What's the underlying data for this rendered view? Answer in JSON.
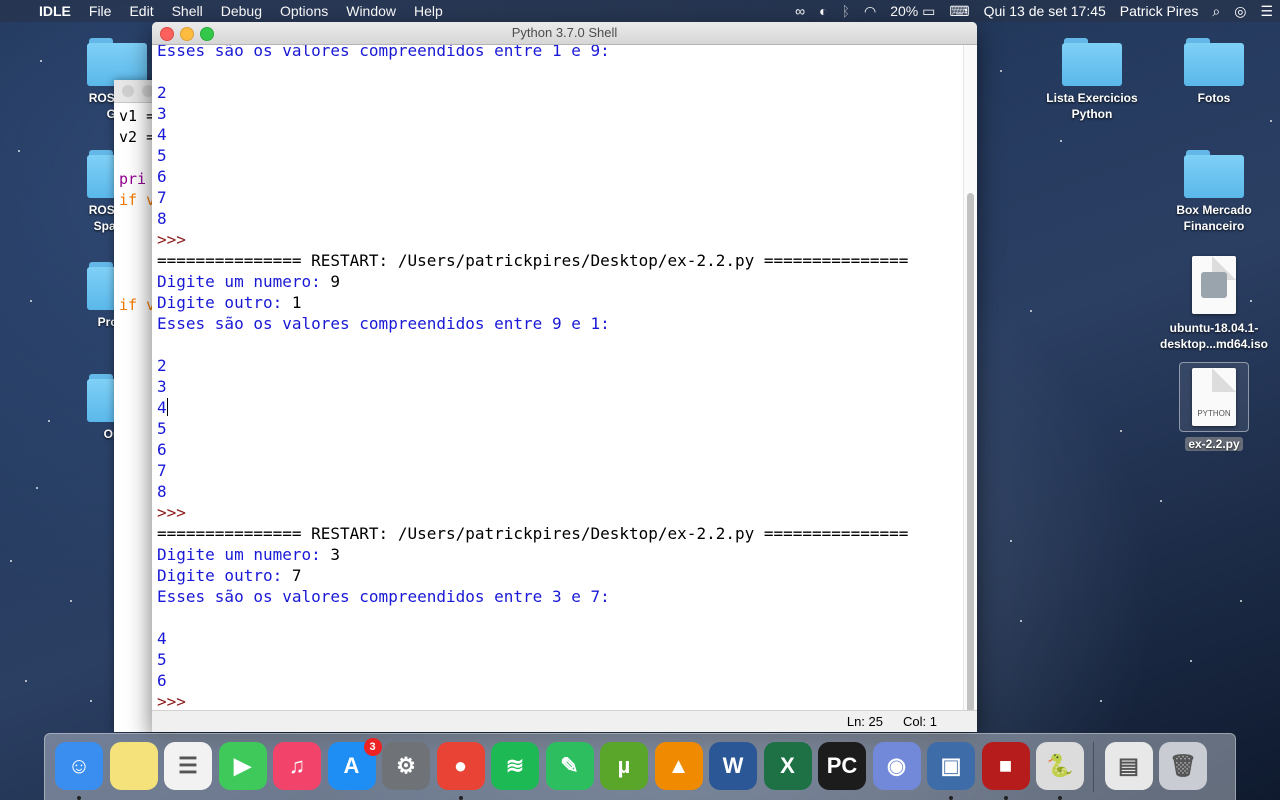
{
  "menubar": {
    "app_name": "IDLE",
    "menus": [
      "File",
      "Edit",
      "Shell",
      "Debug",
      "Options",
      "Window",
      "Help"
    ],
    "battery": "20%",
    "datetime": "Qui 13 de set  17:45",
    "user": "Patrick Pires"
  },
  "desktop": {
    "left_icons": [
      {
        "label": "ROSETTA",
        "label2": "Ger"
      },
      {
        "label": "ROSETTA",
        "label2": "Spanish"
      },
      {
        "label": "Progra",
        "label2": ""
      },
      {
        "label": "Onel",
        "label2": ""
      }
    ],
    "right_icons": [
      {
        "label": "Lista Exercicios",
        "label2": "Python"
      },
      {
        "label": "Fotos",
        "label2": ""
      },
      {
        "label": "Box Mercado",
        "label2": "Financeiro"
      },
      {
        "label": "ubuntu-18.04.1-",
        "label2": "desktop...md64.iso"
      },
      {
        "label": "ex-2.2.py",
        "label2": "",
        "doc_label": "PYTHON"
      }
    ]
  },
  "bg_editor": {
    "lines": [
      "v1 =",
      "v2 =",
      "",
      "pri",
      "if v",
      "",
      "",
      "",
      "",
      "if v"
    ]
  },
  "shell_window": {
    "title": "Python 3.7.0 Shell",
    "lines": [
      {
        "t": "Esses são os valores compreendidos entre 1 e 9:",
        "c": "out"
      },
      {
        "t": "",
        "c": "out"
      },
      {
        "t": "2",
        "c": "out"
      },
      {
        "t": "3",
        "c": "out"
      },
      {
        "t": "4",
        "c": "out"
      },
      {
        "t": "5",
        "c": "out"
      },
      {
        "t": "6",
        "c": "out"
      },
      {
        "t": "7",
        "c": "out"
      },
      {
        "t": "8",
        "c": "out"
      },
      {
        "t": ">>> ",
        "c": "prompt"
      },
      {
        "t": "=============== RESTART: /Users/patrickpires/Desktop/ex-2.2.py ===============",
        "c": "rst"
      },
      {
        "t": "Digite um numero: ",
        "c": "out",
        "u": "9"
      },
      {
        "t": "Digite outro: ",
        "c": "out",
        "u": "1"
      },
      {
        "t": "Esses são os valores compreendidos entre 9 e 1:",
        "c": "out"
      },
      {
        "t": "",
        "c": "out"
      },
      {
        "t": "2",
        "c": "out"
      },
      {
        "t": "3",
        "c": "out"
      },
      {
        "t": "4",
        "c": "out",
        "cursor": true
      },
      {
        "t": "5",
        "c": "out"
      },
      {
        "t": "6",
        "c": "out"
      },
      {
        "t": "7",
        "c": "out"
      },
      {
        "t": "8",
        "c": "out"
      },
      {
        "t": ">>> ",
        "c": "prompt"
      },
      {
        "t": "=============== RESTART: /Users/patrickpires/Desktop/ex-2.2.py ===============",
        "c": "rst"
      },
      {
        "t": "Digite um numero: ",
        "c": "out",
        "u": "3"
      },
      {
        "t": "Digite outro: ",
        "c": "out",
        "u": "7"
      },
      {
        "t": "Esses são os valores compreendidos entre 3 e 7:",
        "c": "out"
      },
      {
        "t": "",
        "c": "out"
      },
      {
        "t": "4",
        "c": "out"
      },
      {
        "t": "5",
        "c": "out"
      },
      {
        "t": "6",
        "c": "out"
      },
      {
        "t": ">>> ",
        "c": "prompt"
      }
    ],
    "status_ln": "Ln: 25",
    "status_col": "Col: 1"
  },
  "dock": {
    "apps": [
      {
        "name": "finder-icon",
        "glyph": "☺",
        "color": "#3a8ef0",
        "dot": true
      },
      {
        "name": "notes-icon",
        "glyph": "",
        "color": "#f5e27a",
        "dot": false
      },
      {
        "name": "reminders-icon",
        "glyph": "☰",
        "color": "#f2f2f2",
        "dot": false
      },
      {
        "name": "facetime-icon",
        "glyph": "▶",
        "color": "#3ec95a",
        "dot": false
      },
      {
        "name": "itunes-icon",
        "glyph": "♫",
        "color": "#f2436a",
        "dot": false
      },
      {
        "name": "app-store-icon",
        "glyph": "A",
        "color": "#1e8ef5",
        "dot": false,
        "badge": "3"
      },
      {
        "name": "system-preferences-icon",
        "glyph": "⚙",
        "color": "#6f7378",
        "dot": false
      },
      {
        "name": "chrome-icon",
        "glyph": "●",
        "color": "#e84335",
        "dot": true
      },
      {
        "name": "spotify-icon",
        "glyph": "≋",
        "color": "#1db954",
        "dot": false
      },
      {
        "name": "evernote-icon",
        "glyph": "✎",
        "color": "#2dbe60",
        "dot": false
      },
      {
        "name": "utorrent-icon",
        "glyph": "µ",
        "color": "#5aa62a",
        "dot": false
      },
      {
        "name": "vlc-icon",
        "glyph": "▲",
        "color": "#f08a00",
        "dot": false
      },
      {
        "name": "word-icon",
        "glyph": "W",
        "color": "#2b5797",
        "dot": false
      },
      {
        "name": "excel-icon",
        "glyph": "X",
        "color": "#1e7145",
        "dot": false
      },
      {
        "name": "pycharm-icon",
        "glyph": "PC",
        "color": "#1c1c1c",
        "dot": false
      },
      {
        "name": "discord-icon",
        "glyph": "◉",
        "color": "#7289da",
        "dot": false
      },
      {
        "name": "virtualbox-icon",
        "glyph": "▣",
        "color": "#3d6ca8",
        "dot": true
      },
      {
        "name": "photo-booth-icon",
        "glyph": "■",
        "color": "#b71c1c",
        "dot": true
      },
      {
        "name": "python-launcher-icon",
        "glyph": "🐍",
        "color": "#dcdcdc",
        "dot": true
      },
      {
        "name": "screenshot-folder-icon",
        "glyph": "▤",
        "color": "#e8e8e8",
        "dot": false
      },
      {
        "name": "trash-icon",
        "glyph": "🗑",
        "color": "#c9ccd2",
        "dot": false
      }
    ]
  }
}
